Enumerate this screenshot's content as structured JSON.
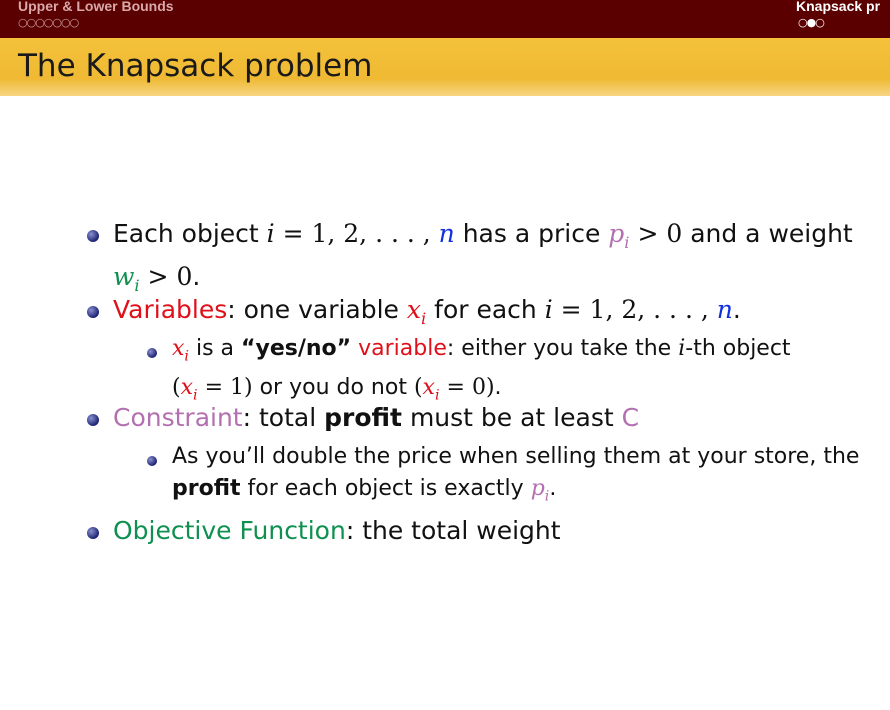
{
  "header": {
    "left_section": "Upper & Lower Bounds",
    "left_dots": "○○○○○○○",
    "right_section": "Knapsack pr",
    "right_dots": "○●○"
  },
  "title": "The Knapsack problem",
  "bullets": {
    "b1": {
      "t1": "Each object ",
      "m1": "i",
      "t2": " = 1, 2, . . . , ",
      "n": "n",
      "t3": " has a price ",
      "p": "p",
      "pi": "i",
      "t4": " > 0",
      "t5": " and a weight",
      "w": "w",
      "wi": "i",
      "t6": " > 0",
      "t7": "."
    },
    "b2": {
      "label": "Variables",
      "t1": ": one variable ",
      "x": "x",
      "xi": "i",
      "t2": " for each ",
      "m1": "i",
      "t3": " = 1, 2, . . . , ",
      "n": "n",
      "t4": ".",
      "sub": {
        "x": "x",
        "xi": "i",
        "t1": " is a ",
        "yesno": "“yes/no”",
        "t2": " ",
        "variable": "variable",
        "t3": ": either you take the ",
        "m1": "i",
        "t4": "-th object",
        "p1": "(",
        "x2": "x",
        "x2i": "i",
        "e1": " = 1)",
        "t5": " or you do not ",
        "p2": "(",
        "x3": "x",
        "x3i": "i",
        "e2": " = 0)",
        "t6": "."
      }
    },
    "b3": {
      "label": "Constraint",
      "t1": ": total ",
      "profit": "profit",
      "t2": " must be at least ",
      "c": "C",
      "sub": {
        "t1": "As you’ll double the price when selling them at your store, the",
        "profit": "profit",
        "t2": " for each object is exactly ",
        "p": "p",
        "pi": "i",
        "t3": "."
      }
    },
    "b4": {
      "label": "Objective Function",
      "t1": ": the total weight"
    }
  }
}
